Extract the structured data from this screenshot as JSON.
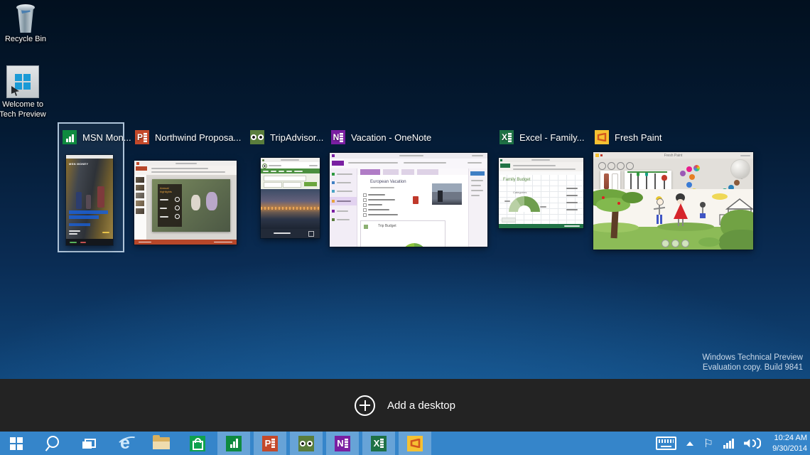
{
  "desktop": {
    "icons": [
      {
        "label": "Recycle Bin"
      },
      {
        "label": "Welcome to Tech Preview"
      }
    ],
    "watermark": {
      "line1": "Windows Technical Preview",
      "line2": "Evaluation copy. Build 9841"
    }
  },
  "task_view": {
    "add_desktop_label": "Add a desktop",
    "windows": [
      {
        "label": "MSN Mon...",
        "app": "MSN Money",
        "selected": true,
        "content": {
          "header": "MSN MONEY"
        }
      },
      {
        "label": "Northwind Proposa...",
        "app": "PowerPoint",
        "content": {
          "slide_title": "Annual highlights"
        }
      },
      {
        "label": "TripAdvisor...",
        "app": "TripAdvisor",
        "content": {}
      },
      {
        "label": "Vacation - OneNote",
        "app": "OneNote",
        "content": {
          "page_title": "European Vacation",
          "box_title": "Trip Budget"
        }
      },
      {
        "label": "Excel - Family...",
        "app": "Excel",
        "content": {
          "sheet_title": "Family Budget",
          "chart_title": "Categories"
        }
      },
      {
        "label": "Fresh Paint",
        "app": "Fresh Paint",
        "content": {
          "window_title": "Fresh Paint"
        }
      }
    ]
  },
  "taskbar": {
    "buttons": [
      {
        "name": "start"
      },
      {
        "name": "search"
      },
      {
        "name": "task-view"
      },
      {
        "name": "internet-explorer"
      },
      {
        "name": "file-explorer"
      },
      {
        "name": "store"
      },
      {
        "name": "msn-money"
      },
      {
        "name": "powerpoint"
      },
      {
        "name": "tripadvisor"
      },
      {
        "name": "onenote"
      },
      {
        "name": "excel"
      },
      {
        "name": "fresh-paint"
      }
    ],
    "tray": {
      "time": "10:24 AM",
      "date": "9/30/2014"
    }
  },
  "colors": {
    "taskbar": "#3585ca",
    "selection_border": "#aec3d8",
    "black_bar": "#232323",
    "excel_green": "#217346",
    "onenote_purple": "#7a1fa2",
    "powerpoint_red": "#c4492a",
    "freshpaint_yellow": "#f6c132"
  }
}
